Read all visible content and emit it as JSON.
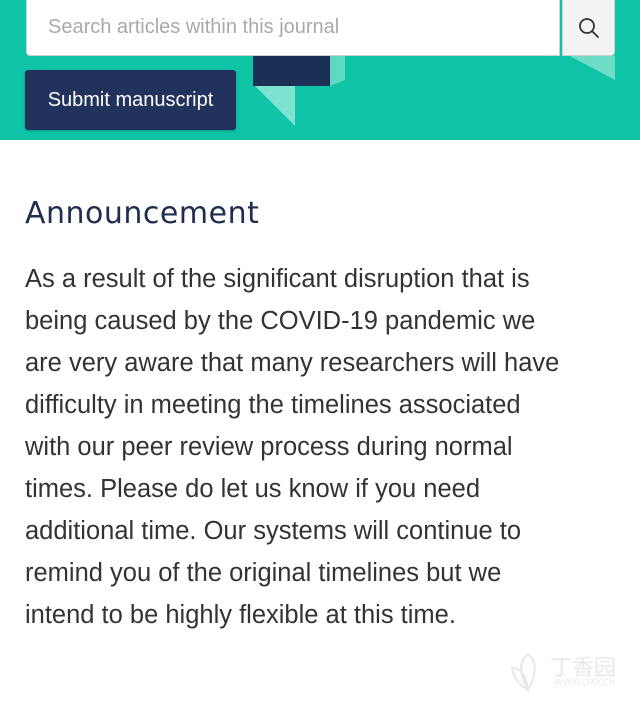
{
  "header": {
    "search": {
      "placeholder": "Search articles within this journal",
      "icon": "search-icon"
    },
    "submit_label": "Submit manuscript",
    "colors": {
      "banner": "#0fc4a6",
      "navy": "#21335c"
    }
  },
  "main": {
    "heading": "Announcement",
    "body": "As a result of the significant disruption that is\nbeing caused by the COVID-19 pandemic we\nare very aware that many researchers will have\ndifficulty in meeting the timelines associated\nwith our peer review process during normal\ntimes.  Please do let us know if you need\nadditional time. Our systems will continue to\nremind you of the original timelines but we\nintend to be highly flexible at this time."
  },
  "watermark": {
    "text": "丁香园",
    "subtext": "WWW.DXY.CN"
  }
}
